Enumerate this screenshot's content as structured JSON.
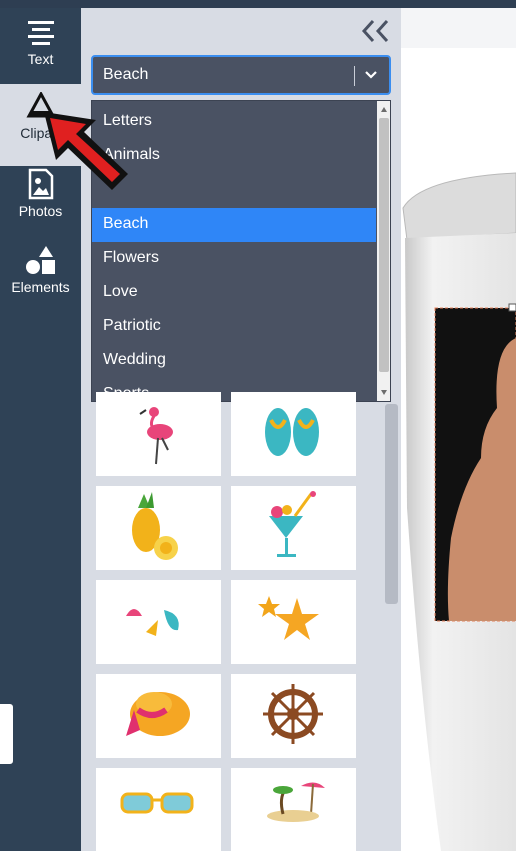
{
  "rail": {
    "items": [
      {
        "label": "Text",
        "icon": "text-align-icon",
        "active": false
      },
      {
        "label": "Clipart",
        "icon": "clipart-icon",
        "active": true
      },
      {
        "label": "Photos",
        "icon": "photo-icon",
        "active": false
      },
      {
        "label": "Elements",
        "icon": "shapes-icon",
        "active": false
      }
    ]
  },
  "panel": {
    "collapse_icon": "double-chevron-left-icon",
    "category_select": {
      "value": "Beach",
      "chevron_icon": "chevron-down-icon",
      "options": [
        "Letters",
        "Animals",
        "",
        "Beach",
        "Flowers",
        "Love",
        "Patriotic",
        "Wedding",
        "Sports"
      ],
      "selected_index": 3
    },
    "clipart_tiles": [
      {
        "icon": "flamingo-icon"
      },
      {
        "icon": "flip-flops-icon"
      },
      {
        "icon": "pineapple-icon"
      },
      {
        "icon": "cocktail-icon"
      },
      {
        "icon": "seashells-icon"
      },
      {
        "icon": "starfish-icon"
      },
      {
        "icon": "sun-hat-icon"
      },
      {
        "icon": "ship-wheel-icon"
      },
      {
        "icon": "sunglasses-icon"
      },
      {
        "icon": "beach-island-icon"
      }
    ]
  },
  "canvas": {
    "product": "tumbler-with-photo"
  },
  "colors": {
    "rail_bg": "#2f4256",
    "panel_bg": "#d8dce4",
    "dropdown_bg": "#4a5263",
    "selected_option": "#2f86f7",
    "select_border": "#3b8ef0"
  }
}
